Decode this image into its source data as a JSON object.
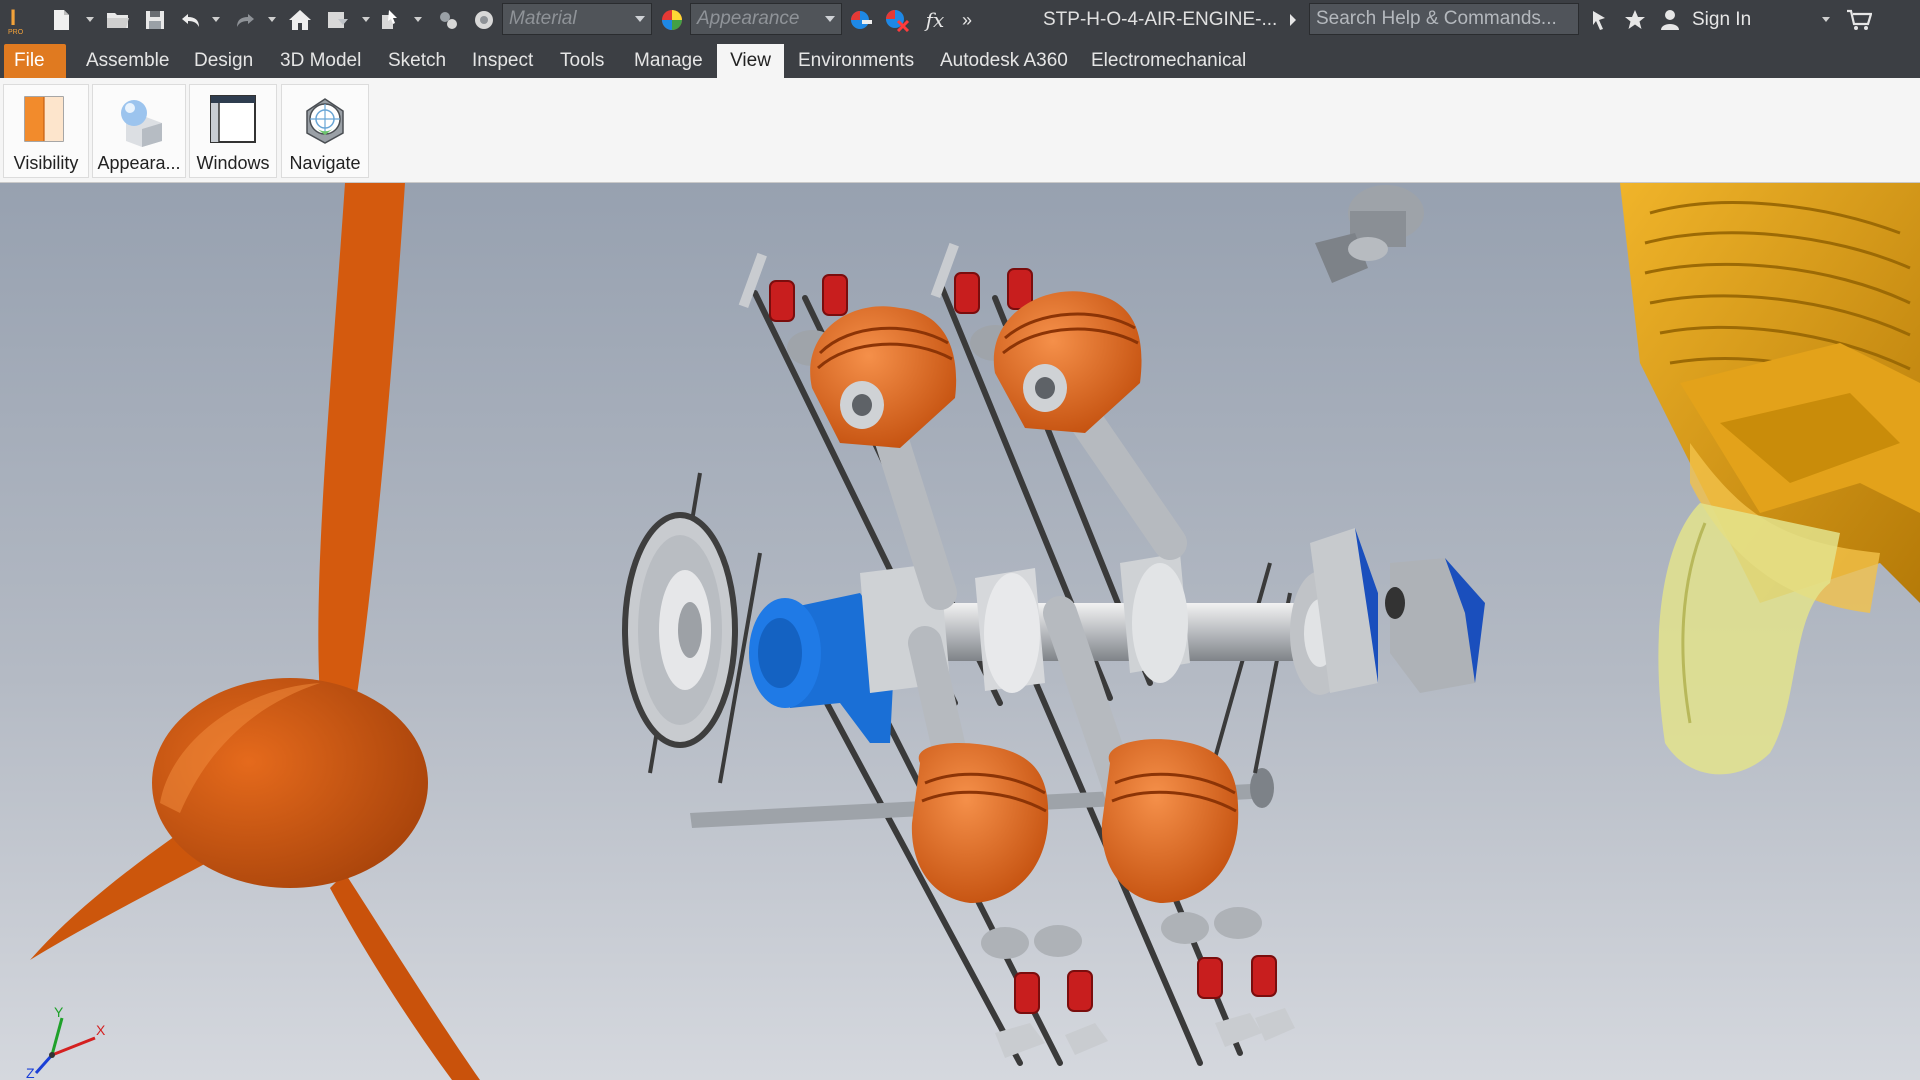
{
  "quick_access": {
    "material_placeholder": "Material",
    "appearance_placeholder": "Appearance",
    "function_glyph": "fx",
    "more_glyph": "»"
  },
  "document_title": "STP-H-O-4-AIR-ENGINE-...",
  "search_placeholder": "Search Help & Commands...",
  "user": {
    "sign_in_label": "Sign In"
  },
  "tabs": [
    {
      "label": "File"
    },
    {
      "label": "Assemble"
    },
    {
      "label": "Design"
    },
    {
      "label": "3D Model"
    },
    {
      "label": "Sketch"
    },
    {
      "label": "Inspect"
    },
    {
      "label": "Tools"
    },
    {
      "label": "Manage"
    },
    {
      "label": "View"
    },
    {
      "label": "Environments"
    },
    {
      "label": "Autodesk A360"
    },
    {
      "label": "Electromechanical"
    }
  ],
  "active_tab": "View",
  "ribbon_buttons": [
    {
      "label": "Visibility",
      "icon": "visibility-icon"
    },
    {
      "label": "Appeara...",
      "icon": "appearance-icon"
    },
    {
      "label": "Windows",
      "icon": "windows-icon"
    },
    {
      "label": "Navigate",
      "icon": "navigate-icon"
    }
  ],
  "view_triad": {
    "x_label": "X",
    "y_label": "Y",
    "z_label": "Z"
  },
  "colors": {
    "app_bar": "#3c3f44",
    "file_tab": "#e07a20",
    "viewport_top": "#9aa4b3",
    "viewport_bottom": "#d3d6dc",
    "propeller": "#d25a10",
    "piston": "#e0691a",
    "accessory_blue": "#1a6fd6",
    "crankcase_gold": "#d49a12",
    "valve_spring": "#c81e1e"
  }
}
